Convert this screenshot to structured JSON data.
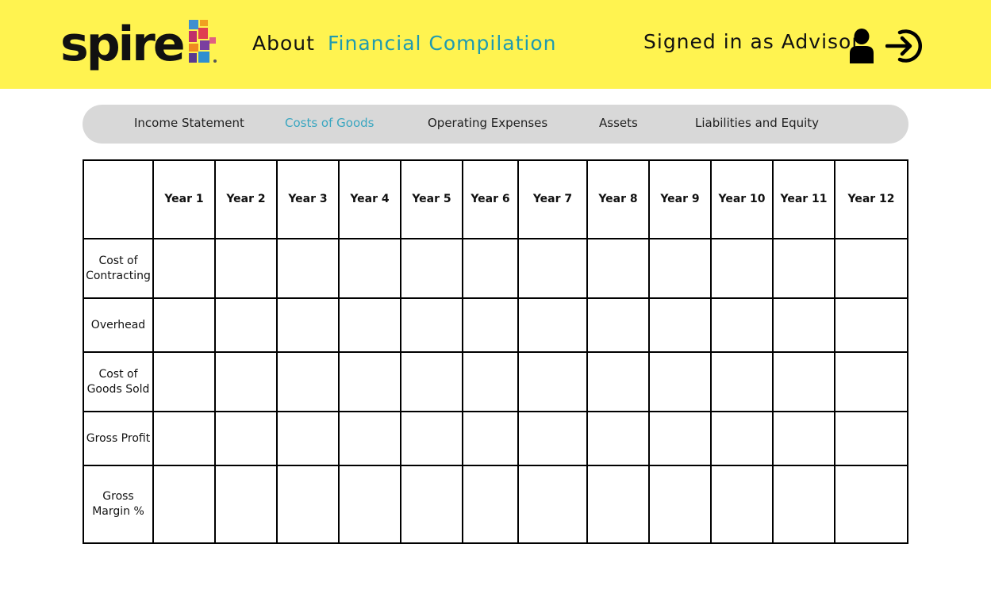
{
  "header": {
    "logo_text": "spire",
    "nav": [
      {
        "label": "About"
      },
      {
        "label": "Financial Compilation"
      }
    ],
    "signed_in_text": "Signed in as Advisor",
    "colors": {
      "background": "#fff350",
      "active_link": "#1f9bb0"
    },
    "icons": {
      "user": "user-icon",
      "logout": "sign-in-arrow-icon"
    }
  },
  "tabs": [
    {
      "label": "Income Statement",
      "active": false
    },
    {
      "label": "Costs of Goods",
      "active": true
    },
    {
      "label": "Operating Expenses",
      "active": false
    },
    {
      "label": "Assets",
      "active": false
    },
    {
      "label": "Liabilities and Equity",
      "active": false
    }
  ],
  "table": {
    "columns": [
      "Year 1",
      "Year 2",
      "Year 3",
      "Year 4",
      "Year 5",
      "Year 6",
      "Year 7",
      "Year 8",
      "Year 9",
      "Year 10",
      "Year 11",
      "Year 12"
    ],
    "rows": [
      "Cost of Contracting",
      "Overhead",
      "Cost of Goods Sold",
      "Gross Profit",
      "Gross Margin %"
    ]
  }
}
